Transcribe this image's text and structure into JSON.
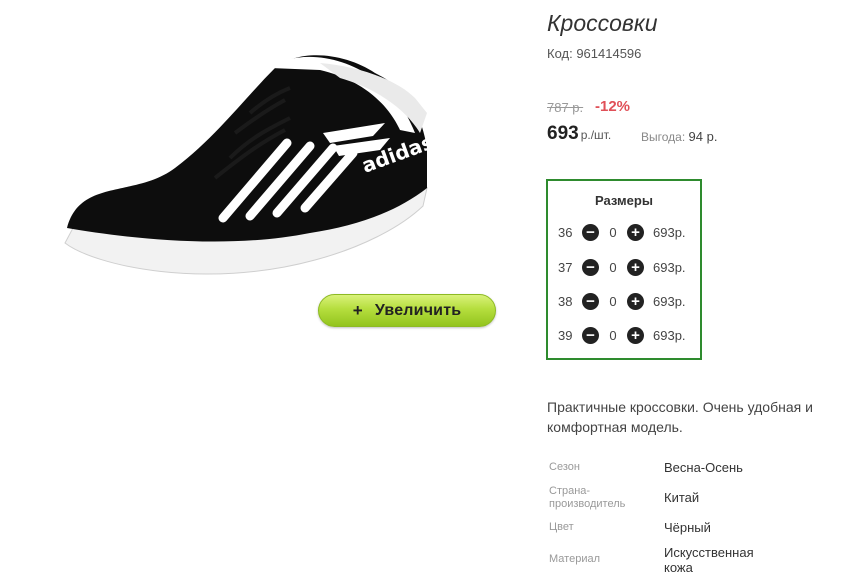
{
  "product": {
    "title": "Кроссовки",
    "code": "Код: 961414596",
    "zoom_label": "Увеличить"
  },
  "pricing": {
    "old_price": "787 р.",
    "discount": "-12%",
    "price": "693",
    "price_unit": "р./шт.",
    "savings_label": "Выгода:",
    "savings_value": "94 р."
  },
  "sizes": {
    "title": "Размеры",
    "rows": [
      {
        "size": "36",
        "qty": "0",
        "price": "693р."
      },
      {
        "size": "37",
        "qty": "0",
        "price": "693р."
      },
      {
        "size": "38",
        "qty": "0",
        "price": "693р."
      },
      {
        "size": "39",
        "qty": "0",
        "price": "693р."
      }
    ]
  },
  "description": "Практичные кроссовки. Очень удобная и комфортная модель.",
  "specs": [
    {
      "label": "Сезон",
      "value": "Весна-Осень"
    },
    {
      "label": "Страна-производитель",
      "value": "Китай"
    },
    {
      "label": "Цвет",
      "value": "Чёрный"
    },
    {
      "label": "Материал",
      "value": "Искусственная кожа"
    }
  ],
  "shoe_brand_text": "adidas",
  "colors": {
    "accent_green": "#2e8b2e",
    "discount_red": "#e05058",
    "zoom_button": "#b5de3e"
  },
  "icons": [
    "plus-icon",
    "minus-circle-icon",
    "plus-circle-icon"
  ]
}
